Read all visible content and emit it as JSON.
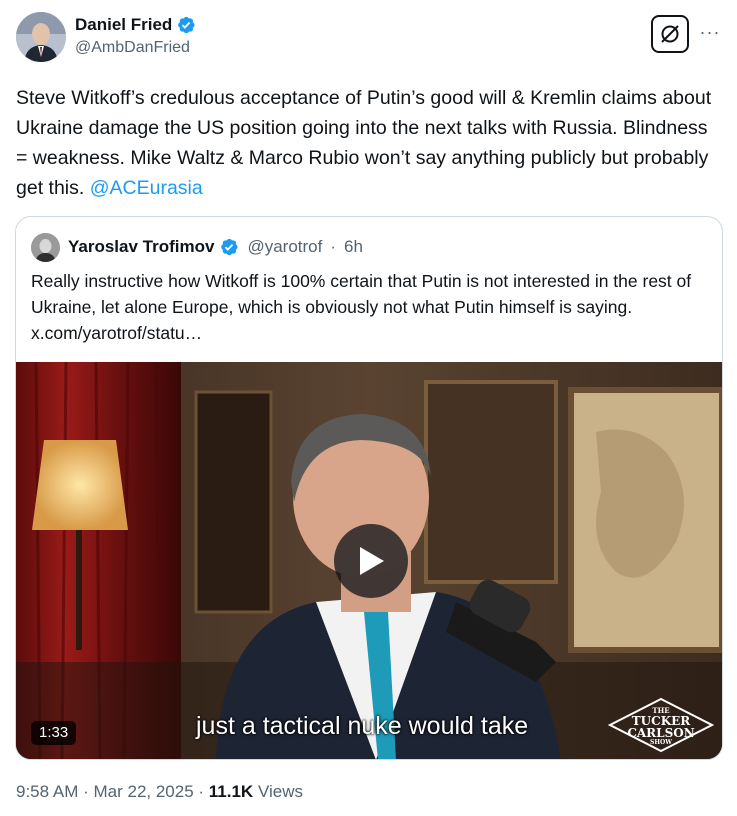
{
  "author": {
    "display_name": "Daniel Fried",
    "handle": "@AmbDanFried",
    "verified_icon": "verified-badge-icon",
    "avatar_icon": "avatar"
  },
  "actions": {
    "grok_icon": "grok-icon",
    "more_icon": "more-options-icon",
    "more_label": "···"
  },
  "tweet": {
    "text": "Steve Witkoff’s credulous acceptance of Putin’s good will & Kremlin claims about Ukraine damage the US position going into the next talks with Russia. Blindness = weakness. Mike Waltz & Marco Rubio won’t say anything publicly but probably get this. ",
    "mention": "@ACEurasia"
  },
  "quoted": {
    "display_name": "Yaroslav Trofimov",
    "handle": "@yarotrof",
    "separator": "·",
    "time": "6h",
    "text": "Really instructive how Witkoff is 100% certain that Putin is not interested in the rest of Ukraine, let alone Europe, which is obviously not what Putin himself is saying.  x.com/yarotrof/statu…",
    "video": {
      "duration": "1:33",
      "caption": "just a tactical nuke would take",
      "logo_line1": "THE",
      "logo_line2": "TUCKER",
      "logo_line3": "CARLSON",
      "logo_line4": "SHOW"
    }
  },
  "meta": {
    "time": "9:58 AM",
    "separator1": " · ",
    "date": "Mar 22, 2025",
    "separator2": " · ",
    "views_count": "11.1K",
    "views_label": " Views"
  },
  "colors": {
    "link": "#1d9bf0",
    "secondary_text": "#536471",
    "primary_text": "#0f1419",
    "border": "#cfd9de"
  }
}
